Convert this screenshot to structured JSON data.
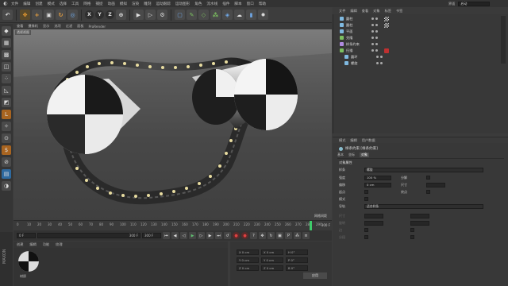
{
  "menubar": {
    "items": [
      "文件",
      "编辑",
      "创建",
      "模式",
      "选择",
      "工具",
      "网格",
      "捕捉",
      "动画",
      "模拟",
      "渲染",
      "雕刻",
      "运动跟踪",
      "运动图形",
      "角色",
      "流水线",
      "插件",
      "脚本",
      "窗口",
      "帮助"
    ]
  },
  "toolbar": {
    "undo_icon": "undo-icon",
    "axis_x": "X",
    "axis_y": "Y",
    "axis_z": "Z"
  },
  "viewport": {
    "menu": [
      "查看",
      "摄像机",
      "显示",
      "选项",
      "过滤",
      "面板",
      "ProRender"
    ],
    "label": "透视视图",
    "grid_spacing": "网格间距"
  },
  "timeline": {
    "ticks": [
      "0",
      "10",
      "20",
      "30",
      "40",
      "50",
      "60",
      "70",
      "80",
      "90",
      "100",
      "110",
      "120",
      "130",
      "140",
      "150",
      "160",
      "170",
      "180",
      "190",
      "200",
      "210",
      "220",
      "230",
      "240",
      "250",
      "260",
      "270",
      "280",
      "290"
    ],
    "frame_end": "300 F",
    "playhead_progress": 0.93
  },
  "transport": {
    "start": "0 F",
    "current": "0 F",
    "end": "300 F",
    "preview_end": "300 F"
  },
  "material": {
    "menu": [
      "创建",
      "编辑",
      "功能",
      "纹理"
    ],
    "name": "材质"
  },
  "coords": {
    "rows": [
      [
        "X 0 cm",
        "X 0 cm",
        "H 0°"
      ],
      [
        "Y 0 cm",
        "Y 0 cm",
        "P 0°"
      ],
      [
        "Z 0 cm",
        "Z 0 cm",
        "B 0°"
      ]
    ],
    "apply": "应用"
  },
  "right_top": {
    "layout_label": "界面",
    "layout_value": "启动"
  },
  "object_manager": {
    "tabs": [
      "文件",
      "编辑",
      "查看",
      "对象",
      "标签",
      "书签"
    ],
    "objects": [
      {
        "name": "圆柱",
        "color": "#7fb9e0"
      },
      {
        "name": "圆柱",
        "color": "#7fb9e0"
      },
      {
        "name": "平面",
        "color": "#7fb9e0"
      },
      {
        "name": "克隆",
        "color": "#7cc060"
      },
      {
        "name": "样条约束",
        "color": "#b08be0"
      },
      {
        "name": "扫描",
        "color": "#7cc060"
      },
      {
        "name": "圆环",
        "color": "#7fb9e0"
      },
      {
        "name": "螺旋",
        "color": "#7fb9e0"
      }
    ]
  },
  "attribute_manager": {
    "tabs": [
      "模式",
      "编辑",
      "用户数据"
    ],
    "title": "样条约束 [样条约束]",
    "sub_tabs": [
      "基本",
      "坐标",
      "对象"
    ],
    "section1": "对象属性",
    "spline_label": "样条",
    "spline_value": "螺旋",
    "rows": [
      {
        "label": "强度",
        "value": "100 %",
        "label2": "分解"
      },
      {
        "label": "偏移",
        "value": "0 cm",
        "label2": "尺寸"
      },
      {
        "label": "起点",
        "value": "",
        "label2": "终点"
      },
      {
        "label": "模式",
        "value": "",
        "label2": ""
      }
    ],
    "section2": "导轨",
    "rail_value": "适合样条",
    "dim_rows": [
      "尺寸",
      "旋转",
      "边",
      "分段"
    ]
  },
  "colors": {
    "accent_orange": "#f0a030",
    "playhead_green": "#3ecb6a",
    "selection_blue": "#2e6aa0"
  }
}
